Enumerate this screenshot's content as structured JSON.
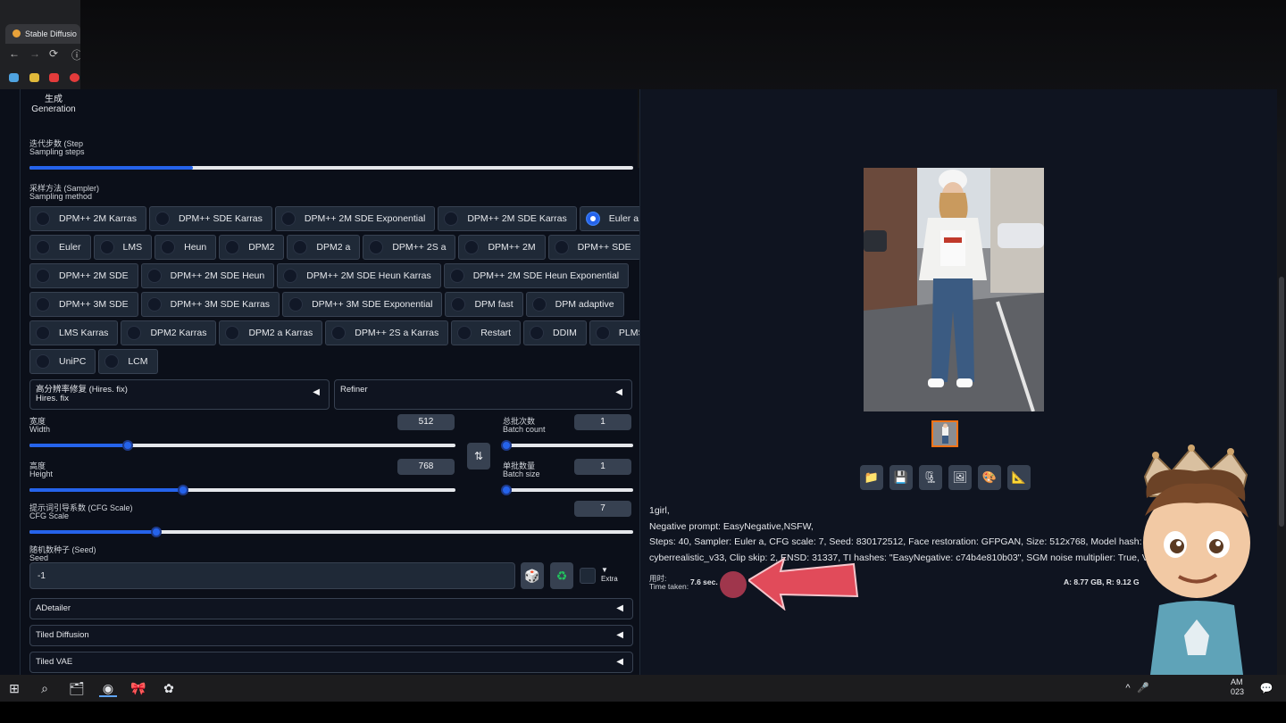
{
  "browser": {
    "tab_title": "Stable Diffusio",
    "nav": {
      "back": "←",
      "forward": "→",
      "reload": "⟳",
      "info": "ⓘ"
    },
    "bookmark_colors": [
      "#4fa3e0",
      "#e0b93a",
      "#e33b3b",
      "#e33b3b"
    ]
  },
  "left": {
    "generation_tab": {
      "zh": "生成",
      "en": "Generation"
    },
    "steps": {
      "zh": "迭代步数 (Step",
      "en": "Sampling steps",
      "fraction": 0.27
    },
    "sampler": {
      "zh": "采样方法 (Sampler)",
      "en": "Sampling method",
      "selected": "Euler a",
      "rows": [
        [
          "DPM++ 2M Karras",
          "DPM++ SDE Karras",
          "DPM++ 2M SDE Exponential",
          "DPM++ 2M SDE Karras",
          "Euler a"
        ],
        [
          "Euler",
          "LMS",
          "Heun",
          "DPM2",
          "DPM2 a",
          "DPM++ 2S a",
          "DPM++ 2M",
          "DPM++ SDE"
        ],
        [
          "DPM++ 2M SDE",
          "DPM++ 2M SDE Heun",
          "DPM++ 2M SDE Heun Karras",
          "DPM++ 2M SDE Heun Exponential"
        ],
        [
          "DPM++ 3M SDE",
          "DPM++ 3M SDE Karras",
          "DPM++ 3M SDE Exponential",
          "DPM fast",
          "DPM adaptive"
        ],
        [
          "LMS Karras",
          "DPM2 Karras",
          "DPM2 a Karras",
          "DPM++ 2S a Karras",
          "Restart",
          "DDIM",
          "PLMS"
        ],
        [
          "UniPC",
          "LCM"
        ]
      ]
    },
    "hires": {
      "zh": "高分辨率修复 (Hires. fix)",
      "en": "Hires. fix",
      "arrow": "◀"
    },
    "refiner": {
      "title": "Refiner",
      "arrow": "◀"
    },
    "width": {
      "zh": "宽度",
      "en": "Width",
      "value": "512",
      "fraction": 0.23
    },
    "height": {
      "zh": "高度",
      "en": "Height",
      "value": "768",
      "fraction": 0.36
    },
    "swap_icon": "⇅",
    "batch_count": {
      "zh": "总批次数",
      "en": "Batch count",
      "value": "1",
      "fraction": 0.0
    },
    "batch_size": {
      "zh": "单批数量",
      "en": "Batch size",
      "value": "1",
      "fraction": 0.0
    },
    "cfg": {
      "zh": "提示词引导系数 (CFG Scale)",
      "en": "CFG Scale",
      "value": "7",
      "fraction": 0.21
    },
    "seed": {
      "zh": "随机数种子 (Seed)",
      "en": "Seed",
      "value": "-1",
      "dice_icon": "🎲",
      "recycle_icon": "♻",
      "extra_arrow": "▼",
      "extra_label": "Extra"
    },
    "accordions": [
      {
        "title": "ADetailer",
        "arrow": "◀"
      },
      {
        "title": "Tiled Diffusion",
        "arrow": "◀"
      },
      {
        "title": "Tiled VAE",
        "arrow": "◀"
      }
    ]
  },
  "right": {
    "tools": [
      "📁",
      "💾",
      "🗜",
      "🖼",
      "🎨",
      "📐"
    ],
    "info_lines": [
      "1girl,",
      "Negative prompt: EasyNegative,NSFW,",
      "Steps: 40, Sampler: Euler a, CFG scale: 7, Seed: 830172512, Face restoration: GFPGAN, Size: 512x768, Model hash: 7a4dbba1",
      "cyberrealistic_v33, Clip skip: 2, ENSD: 31337, TI hashes: \"EasyNegative: c74b4e810b03\", SGM noise multiplier: True, Version"
    ],
    "time": {
      "zh": "用时:",
      "en": "Time taken:",
      "value": "7.6 sec.",
      "memory": "A: 8.77 GB, R: 9.12 G"
    }
  },
  "taskbar": {
    "icons": [
      "⊞",
      "⌕",
      "🗂",
      "◉",
      "🎀",
      "✿"
    ],
    "clock": {
      "time": "AM",
      "date": "023"
    },
    "tray": [
      "^",
      "🎤",
      "💬"
    ]
  }
}
